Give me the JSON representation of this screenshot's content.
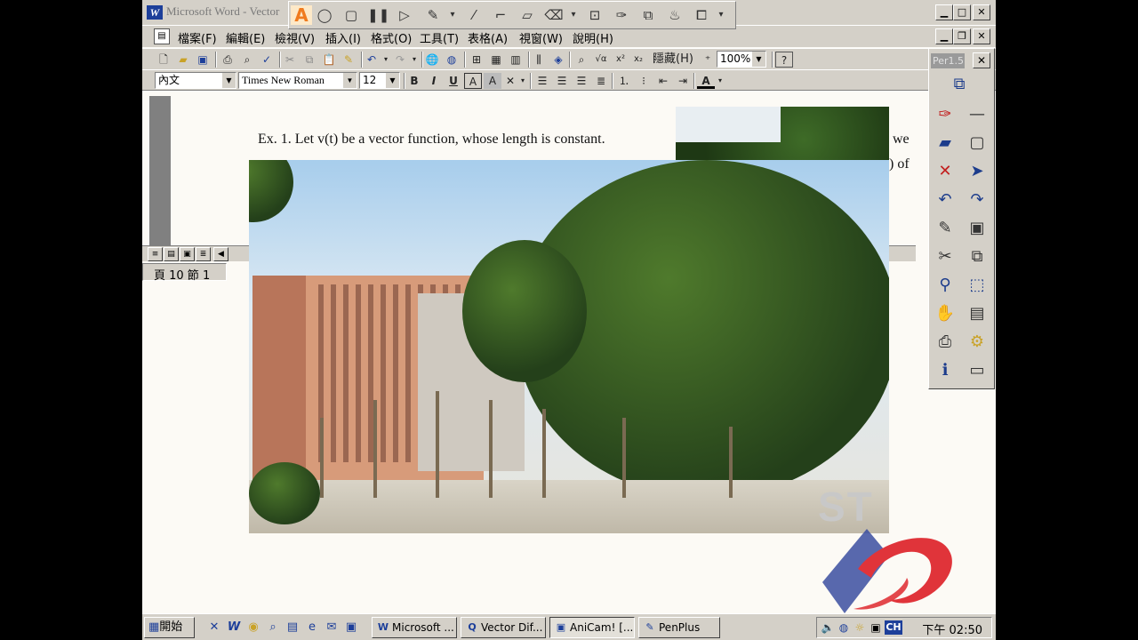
{
  "window": {
    "title": "Microsoft Word - Vector",
    "app_logo": "W"
  },
  "floating_toolbar": {
    "items": [
      "A",
      "◯",
      "▢",
      "❚❚",
      "▷",
      "✎",
      "▾",
      "⁄",
      "⌐",
      "▱",
      "⌫",
      "▾",
      "⊡",
      "✑",
      "⧉",
      "♨",
      "⧠",
      "▾"
    ]
  },
  "menu": {
    "items": [
      "檔案(F)",
      "編輯(E)",
      "檢視(V)",
      "插入(I)",
      "格式(O)",
      "工具(T)",
      "表格(A)",
      "視窗(W)",
      "說明(H)"
    ]
  },
  "toolbar_standard": {
    "hidden_label": "隱藏(H)",
    "zoom": "100%"
  },
  "toolbar_format": {
    "style": "內文",
    "font": "Times New Roman",
    "size": "12",
    "bold": "B",
    "italic": "I",
    "underline": "U"
  },
  "document": {
    "line1": "Ex. 1.   Let v(t) be a vector function, whose length is constant.",
    "line1_tail": "we",
    "line2_tail": ") of"
  },
  "status_bar": {
    "text": "頁 10   節 1"
  },
  "pen_panel": {
    "title": "Per1.5",
    "close_label": "✕"
  },
  "watermark": {
    "text": "ST"
  },
  "taskbar": {
    "start_label": "開始",
    "tasks": [
      {
        "label": "Microsoft ...",
        "icon": "W"
      },
      {
        "label": "Vector Dif...",
        "icon": "Q"
      },
      {
        "label": "AniCam! [...",
        "icon": "▣"
      },
      {
        "label": "PenPlus",
        "icon": "✎"
      }
    ],
    "ime": "CH",
    "clock": "下午 02:50"
  },
  "colors": {
    "chrome": "#d4d0c8",
    "page": "#fcfaf5",
    "logo_red": "#e0343a",
    "logo_blue": "#3b4ea0"
  }
}
